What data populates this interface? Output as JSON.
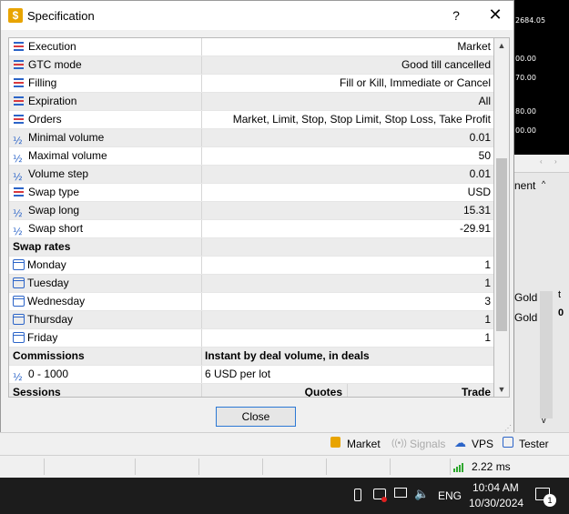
{
  "background": {
    "terminal_values": [
      "2684.05",
      "00.00",
      "70.00",
      "80.00",
      "00.00"
    ],
    "panel_label": "nent",
    "gold_labels": [
      "Gold",
      "Gold"
    ],
    "edge_chars": [
      "t",
      "0"
    ]
  },
  "dialog": {
    "title": "Specification",
    "help_label": "?",
    "close_label": "✕",
    "close_button_label": "Close",
    "rows": [
      {
        "name": "Execution",
        "value": "Market",
        "icon": "list-icon"
      },
      {
        "name": "GTC mode",
        "value": "Good till cancelled",
        "icon": "list-icon"
      },
      {
        "name": "Filling",
        "value": "Fill or Kill, Immediate or Cancel",
        "icon": "list-icon"
      },
      {
        "name": "Expiration",
        "value": "All",
        "icon": "list-icon"
      },
      {
        "name": "Orders",
        "value": "Market, Limit, Stop, Stop Limit, Stop Loss, Take Profit",
        "icon": "list-icon"
      },
      {
        "name": "Minimal volume",
        "value": "0.01",
        "icon": "half-icon"
      },
      {
        "name": "Maximal volume",
        "value": "50",
        "icon": "half-icon"
      },
      {
        "name": "Volume step",
        "value": "0.01",
        "icon": "half-icon"
      },
      {
        "name": "Swap type",
        "value": "USD",
        "icon": "list-icon"
      },
      {
        "name": "Swap long",
        "value": "15.31",
        "icon": "half-icon"
      },
      {
        "name": "Swap short",
        "value": "-29.91",
        "icon": "half-icon"
      },
      {
        "name": "Swap rates",
        "value": "",
        "header": true
      },
      {
        "name": "Monday",
        "value": "1",
        "icon": "calendar-icon"
      },
      {
        "name": "Tuesday",
        "value": "1",
        "icon": "calendar-icon"
      },
      {
        "name": "Wednesday",
        "value": "3",
        "icon": "calendar-icon"
      },
      {
        "name": "Thursday",
        "value": "1",
        "icon": "calendar-icon"
      },
      {
        "name": "Friday",
        "value": "1",
        "icon": "calendar-icon"
      },
      {
        "name": "Commissions",
        "value": "Instant by deal volume, in deals",
        "header": true
      },
      {
        "name": "0 - 1000",
        "value": "6 USD per lot",
        "icon": "half-icon"
      },
      {
        "name": "Sessions",
        "quotes": "Quotes",
        "trade": "Trade",
        "header": true
      }
    ]
  },
  "toolbar": {
    "market": "Market",
    "signals": "Signals",
    "vps": "VPS",
    "tester": "Tester"
  },
  "status": {
    "ping": "2.22 ms"
  },
  "taskbar": {
    "language": "ENG",
    "time": "10:04 AM",
    "date": "10/30/2024",
    "notification_count": "1"
  },
  "colors": {
    "accent": "#2b64c8",
    "list_icon_colors": [
      "#2b64c8",
      "#d8393f",
      "#2b64c8"
    ],
    "market_icon": "#e8a400",
    "ping_green": "#2fa82f"
  }
}
